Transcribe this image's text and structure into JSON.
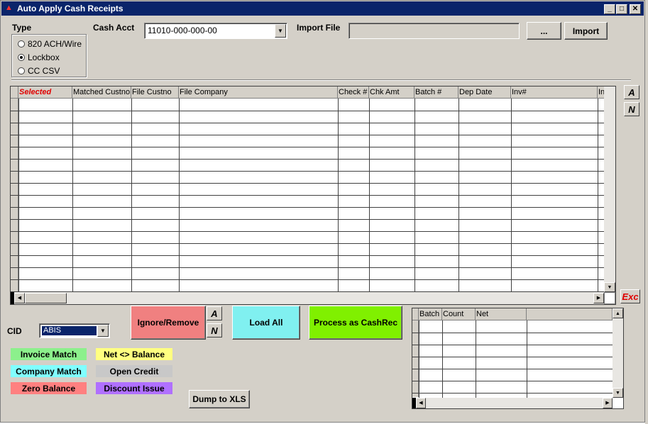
{
  "window": {
    "title": "Auto Apply Cash Receipts",
    "icon": "app-icon",
    "buttons": [
      "minimize-icon",
      "maximize-icon",
      "close-icon"
    ]
  },
  "type_group": {
    "label": "Type",
    "options": [
      {
        "label": "820 ACH/Wire",
        "selected": false
      },
      {
        "label": "Lockbox",
        "selected": true
      },
      {
        "label": "CC CSV",
        "selected": false
      }
    ]
  },
  "cash_acct": {
    "label": "Cash Acct",
    "value": "11010-000-000-00"
  },
  "import_file": {
    "label": "Import File",
    "value": "",
    "browse_label": "...",
    "import_label": "Import"
  },
  "main_grid": {
    "columns": [
      "Selected",
      "Matched Custno",
      "File Custno",
      "File Company",
      "Check #",
      "Chk Amt",
      "Batch #",
      "Dep Date",
      "Inv#",
      "In"
    ],
    "row_count": 16
  },
  "side_buttons": {
    "a_label": "A",
    "n_label": "N",
    "exc_label": "Exc"
  },
  "cid": {
    "label": "CID",
    "value": "ABIS"
  },
  "actions": {
    "ignore_remove": "Ignore/Remove",
    "a_label": "A",
    "n_label": "N",
    "load_all": "Load All",
    "process": "Process as CashRec",
    "dump": "Dump to XLS"
  },
  "legend": [
    {
      "label": "Invoice Match",
      "color": "#8cf08c"
    },
    {
      "label": "Net <> Balance",
      "color": "#ffff80"
    },
    {
      "label": "Company Match",
      "color": "#80ffff"
    },
    {
      "label": "Open Credit",
      "color": "#c8c8c8"
    },
    {
      "label": "Zero Balance",
      "color": "#ff8080"
    },
    {
      "label": "Discount Issue",
      "color": "#b070ff"
    }
  ],
  "summary_grid": {
    "columns": [
      "Batch",
      "Count",
      "Net"
    ],
    "row_count": 7
  },
  "colors": {
    "ignore_remove": "#f08080",
    "load_all": "#80f0f0",
    "process": "#80f000",
    "title_bar": "#0a246a",
    "selected_header": "#e00000"
  }
}
